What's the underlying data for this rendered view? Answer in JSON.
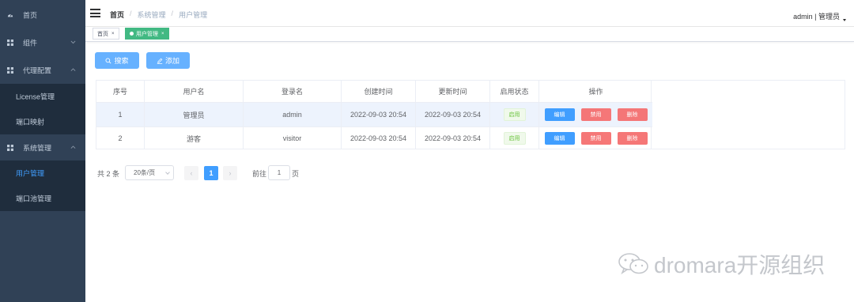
{
  "sidebar": {
    "items": [
      {
        "label": "首页",
        "icon": "dashboard-icon"
      },
      {
        "label": "组件",
        "icon": "grid-icon",
        "chevron": "down"
      },
      {
        "label": "代理配置",
        "icon": "grid-icon",
        "chevron": "up"
      },
      {
        "label": "License管理",
        "sub": true
      },
      {
        "label": "端口映射",
        "sub": true
      },
      {
        "label": "系统管理",
        "icon": "grid-icon",
        "chevron": "up"
      },
      {
        "label": "用户管理",
        "sub": true,
        "active": true
      },
      {
        "label": "端口池管理",
        "sub": true
      }
    ]
  },
  "header": {
    "breadcrumb": [
      "首页",
      "系统管理",
      "用户管理"
    ],
    "separator": "/",
    "user_label": "admin | 管理员"
  },
  "tags": [
    {
      "label": "首页",
      "close": "×"
    },
    {
      "label": "用户管理",
      "close": "×",
      "active": true
    }
  ],
  "toolbar": {
    "search_label": "搜索",
    "add_label": "添加"
  },
  "table": {
    "columns": [
      "序号",
      "用户名",
      "登录名",
      "创建时间",
      "更新时间",
      "启用状态",
      "操作"
    ],
    "rows": [
      {
        "index": "1",
        "username": "管理员",
        "login": "admin",
        "created": "2022-09-03 20:54",
        "updated": "2022-09-03 20:54",
        "status": "启用"
      },
      {
        "index": "2",
        "username": "游客",
        "login": "visitor",
        "created": "2022-09-03 20:54",
        "updated": "2022-09-03 20:54",
        "status": "启用"
      }
    ],
    "actions": {
      "edit": "编辑",
      "disable": "禁用",
      "delete": "删除"
    }
  },
  "pagination": {
    "total": "共 2 条",
    "page_size": "20条/页",
    "prev": "‹",
    "current": "1",
    "next": "›",
    "goto_prefix": "前往",
    "goto_value": "1",
    "goto_suffix": "页"
  },
  "watermark": {
    "text": "dromara开源组织"
  },
  "colors": {
    "sidebar_bg": "#304156",
    "submenu_bg": "#1f2d3d",
    "primary": "#409eff",
    "success_tag": "#42b983",
    "danger": "#f56c6c"
  }
}
